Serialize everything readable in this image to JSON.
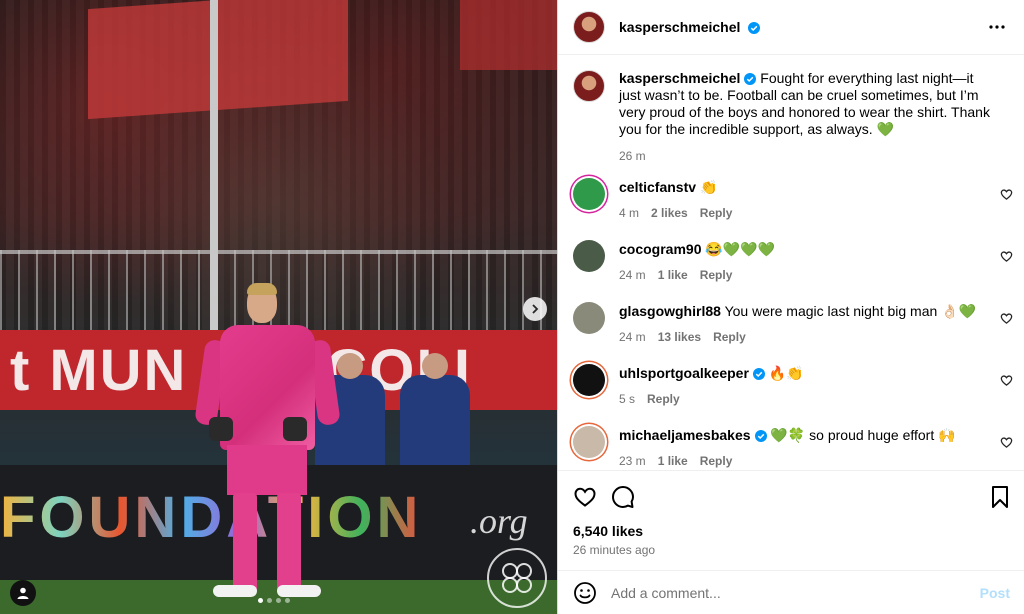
{
  "photo": {
    "banner_text": [
      "t",
      "MUN",
      "COLI"
    ],
    "ad_text": "FOUNDATION",
    "ad_suffix": ".org",
    "carousel_count": 4,
    "carousel_active": 0
  },
  "header": {
    "username": "kasperschmeichel",
    "verified": true
  },
  "caption": {
    "username": "kasperschmeichel",
    "text": "Fought for everything last night—it just wasn’t to be. Football can be cruel sometimes, but I’m very proud of the boys and honored to wear the shirt. Thank you for the incredible support, as always. 💚",
    "time": "26 m"
  },
  "comments": [
    {
      "username": "celticfanstv",
      "verified": false,
      "text": "👏",
      "time": "4 m",
      "likes": "2 likes",
      "reply": "Reply",
      "avatar_color": "#2f9a4a"
    },
    {
      "username": "cocogram90",
      "verified": false,
      "text": "😂💚💚💚",
      "time": "24 m",
      "likes": "1 like",
      "reply": "Reply",
      "avatar_color": "#4a5b48"
    },
    {
      "username": "glasgowghirl88",
      "verified": false,
      "text": "You were magic last night big man 👌🏻💚",
      "time": "24 m",
      "likes": "13 likes",
      "reply": "Reply",
      "avatar_color": "#8a8a7a"
    },
    {
      "username": "uhlsportgoalkeeper",
      "verified": true,
      "text": "🔥👏",
      "time": "5 s",
      "likes": "",
      "reply": "Reply",
      "avatar_color": "#111111"
    },
    {
      "username": "michaeljamesbakes",
      "verified": true,
      "text": "💚🍀 so proud huge effort 🙌",
      "time": "23 m",
      "likes": "1 like",
      "reply": "Reply",
      "avatar_color": "#c9b9a8"
    }
  ],
  "stats": {
    "likes": "6,540 likes",
    "ago": "26 minutes ago"
  },
  "composer": {
    "placeholder": "Add a comment...",
    "post_label": "Post"
  },
  "colors": {
    "verified": "#0095f6",
    "post_disabled": "#b2dffc",
    "muted": "#737373"
  }
}
